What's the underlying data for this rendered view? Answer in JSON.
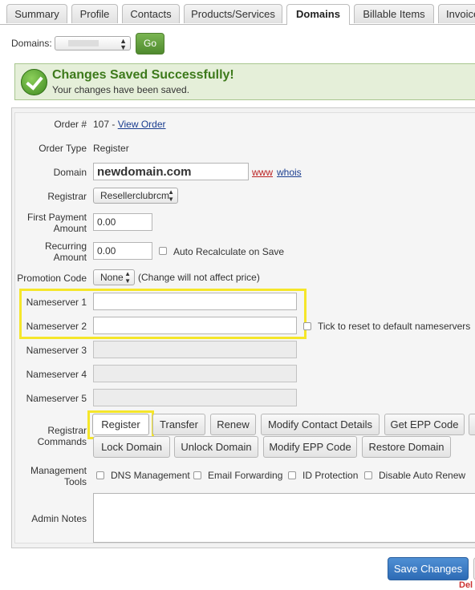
{
  "tabs": [
    {
      "label": "Summary"
    },
    {
      "label": "Profile"
    },
    {
      "label": "Contacts"
    },
    {
      "label": "Products/Services"
    },
    {
      "label": "Domains",
      "active": true
    },
    {
      "label": "Billable Items"
    },
    {
      "label": "Invoices"
    }
  ],
  "domain_selector": {
    "label": "Domains:",
    "go_label": "Go"
  },
  "success": {
    "title": "Changes Saved Successfully!",
    "message": "Your changes have been saved."
  },
  "order": {
    "order_label": "Order #",
    "order_number": "107",
    "order_sep": " - ",
    "view_order": "View Order",
    "type_label": "Order Type",
    "type_value": "Register",
    "domain_label": "Domain",
    "domain_value": "newdomain.com",
    "www": "www",
    "whois": "whois",
    "registrar_label": "Registrar",
    "registrar_value": "Resellerclubrcm",
    "first_payment_label_1": "First Payment",
    "first_payment_label_2": "Amount",
    "first_payment_value": "0.00",
    "recurring_label_1": "Recurring",
    "recurring_label_2": "Amount",
    "recurring_value": "0.00",
    "auto_recalc": "Auto Recalculate on Save",
    "promo_label": "Promotion Code",
    "promo_value": "None",
    "promo_note": "(Change will not affect price)"
  },
  "nameservers": {
    "ns1": "Nameserver 1",
    "ns2": "Nameserver 2",
    "ns3": "Nameserver 3",
    "ns4": "Nameserver 4",
    "ns5": "Nameserver 5",
    "reset_label": "Tick to reset to default nameservers"
  },
  "registrar_commands": {
    "label_1": "Registrar",
    "label_2": "Commands",
    "buttons": [
      "Register",
      "Transfer",
      "Renew",
      "Modify Contact Details",
      "Get EPP Code",
      "Lock Domain",
      "Unlock Domain",
      "Modify EPP Code",
      "Restore Domain"
    ]
  },
  "management_tools": {
    "label_1": "Management",
    "label_2": "Tools",
    "options": [
      "DNS Management",
      "Email Forwarding",
      "ID Protection",
      "Disable Auto Renew"
    ]
  },
  "admin_notes": {
    "label": "Admin Notes"
  },
  "footer": {
    "save_label": "Save Changes",
    "partial_red_text": "Del"
  },
  "colors": {
    "accent": "#2d6bb5",
    "success_bg": "#e5efd9",
    "success_text": "#3d7a1b",
    "highlight": "#f5e62a"
  }
}
